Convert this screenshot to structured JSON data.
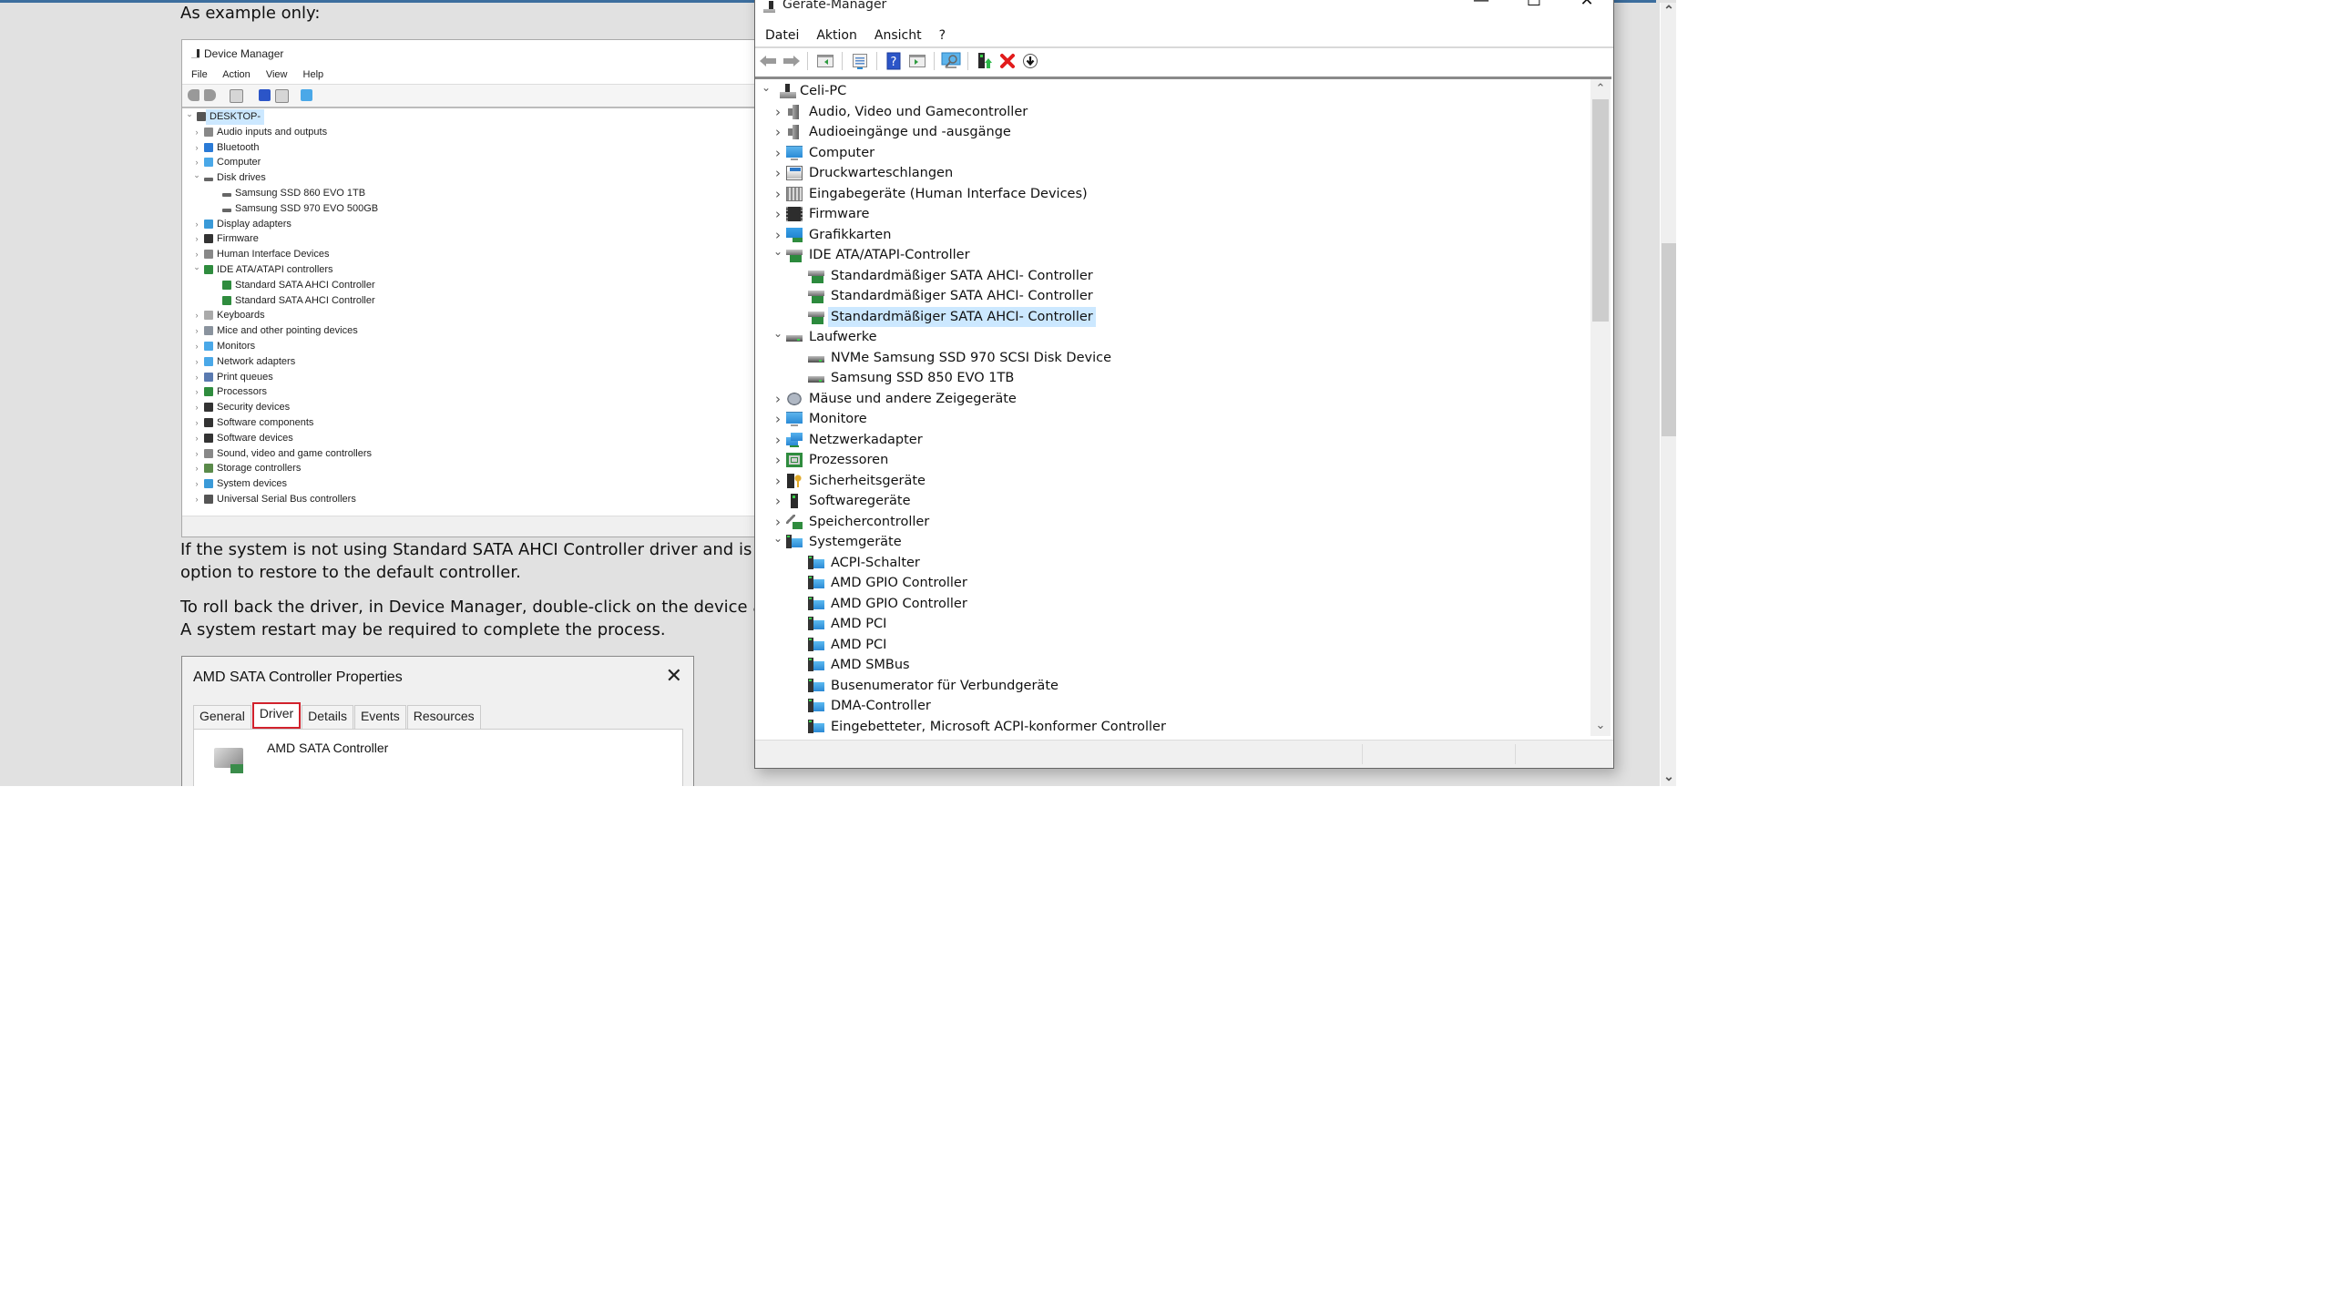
{
  "page": {
    "intro_label": "As example only:",
    "paragraph1_line1": "If the system is not using Standard SATA AHCI Controller driver and is experie",
    "paragraph1_line2": "option to restore to the default controller.",
    "paragraph2_line1": "To roll back the driver, in Device Manager, double-click on the device and sele",
    "paragraph2_line2": "A system restart may be required to complete the process."
  },
  "example_device_manager": {
    "title": "Device Manager",
    "menu": [
      "File",
      "Action",
      "View",
      "Help"
    ],
    "root": "DESKTOP-",
    "items": [
      {
        "label": "Audio inputs and outputs",
        "level": 1,
        "state": "collapsed",
        "icon": "speaker-icon"
      },
      {
        "label": "Bluetooth",
        "level": 1,
        "state": "collapsed",
        "icon": "bluetooth-icon"
      },
      {
        "label": "Computer",
        "level": 1,
        "state": "collapsed",
        "icon": "monitor-icon"
      },
      {
        "label": "Disk drives",
        "level": 1,
        "state": "expanded",
        "icon": "disk-icon"
      },
      {
        "label": "Samsung SSD 860 EVO 1TB",
        "level": 2,
        "state": "leaf",
        "icon": "disk-icon"
      },
      {
        "label": "Samsung SSD 970 EVO 500GB",
        "level": 2,
        "state": "leaf",
        "icon": "disk-icon"
      },
      {
        "label": "Display adapters",
        "level": 1,
        "state": "collapsed",
        "icon": "display-adapter-icon"
      },
      {
        "label": "Firmware",
        "level": 1,
        "state": "collapsed",
        "icon": "chip-icon"
      },
      {
        "label": "Human Interface Devices",
        "level": 1,
        "state": "collapsed",
        "icon": "hid-icon"
      },
      {
        "label": "IDE ATA/ATAPI controllers",
        "level": 1,
        "state": "expanded",
        "icon": "ide-controller-icon"
      },
      {
        "label": "Standard SATA AHCI Controller",
        "level": 2,
        "state": "leaf",
        "icon": "ide-controller-icon"
      },
      {
        "label": "Standard SATA AHCI Controller",
        "level": 2,
        "state": "leaf",
        "icon": "ide-controller-icon"
      },
      {
        "label": "Keyboards",
        "level": 1,
        "state": "collapsed",
        "icon": "keyboard-icon"
      },
      {
        "label": "Mice and other pointing devices",
        "level": 1,
        "state": "collapsed",
        "icon": "mouse-icon"
      },
      {
        "label": "Monitors",
        "level": 1,
        "state": "collapsed",
        "icon": "monitor-icon"
      },
      {
        "label": "Network adapters",
        "level": 1,
        "state": "collapsed",
        "icon": "network-icon"
      },
      {
        "label": "Print queues",
        "level": 1,
        "state": "collapsed",
        "icon": "printer-icon"
      },
      {
        "label": "Processors",
        "level": 1,
        "state": "collapsed",
        "icon": "cpu-icon"
      },
      {
        "label": "Security devices",
        "level": 1,
        "state": "collapsed",
        "icon": "security-icon"
      },
      {
        "label": "Software components",
        "level": 1,
        "state": "collapsed",
        "icon": "software-component-icon"
      },
      {
        "label": "Software devices",
        "level": 1,
        "state": "collapsed",
        "icon": "software-device-icon"
      },
      {
        "label": "Sound, video and game controllers",
        "level": 1,
        "state": "collapsed",
        "icon": "speaker-icon"
      },
      {
        "label": "Storage controllers",
        "level": 1,
        "state": "collapsed",
        "icon": "storage-icon"
      },
      {
        "label": "System devices",
        "level": 1,
        "state": "collapsed",
        "icon": "system-device-icon"
      },
      {
        "label": "Universal Serial Bus controllers",
        "level": 1,
        "state": "collapsed",
        "icon": "usb-icon"
      }
    ]
  },
  "properties_dialog": {
    "title": "AMD SATA Controller Properties",
    "close_glyph": "✕",
    "tabs": [
      {
        "label": "General",
        "active": false
      },
      {
        "label": "Driver",
        "active": true,
        "highlighted": true
      },
      {
        "label": "Details",
        "active": false
      },
      {
        "label": "Events",
        "active": false
      },
      {
        "label": "Resources",
        "active": false
      }
    ],
    "device_name": "AMD SATA Controller",
    "highlight_color": "#d2222d"
  },
  "geraete_manager": {
    "title": "Geräte-Manager",
    "window_controls": {
      "minimize": "—",
      "maximize": "☐",
      "close": "✕"
    },
    "menu": [
      "Datei",
      "Aktion",
      "Ansicht",
      "?"
    ],
    "toolbar": [
      {
        "name": "back",
        "icon": "back-arrow-icon"
      },
      {
        "name": "forward",
        "icon": "forward-arrow-icon"
      },
      {
        "name": "show-hide-console-tree",
        "icon": "console-tree-icon"
      },
      {
        "name": "properties",
        "icon": "properties-icon"
      },
      {
        "name": "help",
        "icon": "help-icon",
        "glyph": "?"
      },
      {
        "name": "action-pane",
        "icon": "action-pane-icon"
      },
      {
        "name": "scan-hardware",
        "icon": "scan-hardware-icon"
      },
      {
        "name": "update-driver",
        "icon": "update-driver-icon"
      },
      {
        "name": "uninstall-device",
        "icon": "uninstall-icon",
        "glyph": "✖"
      },
      {
        "name": "disable-device",
        "icon": "disable-device-icon",
        "glyph": "⬇"
      }
    ],
    "root": "Celi-PC",
    "items": [
      {
        "label": "Audio, Video und Gamecontroller",
        "level": 1,
        "state": "collapsed",
        "icon": "speaker"
      },
      {
        "label": "Audioeingänge und -ausgänge",
        "level": 1,
        "state": "collapsed",
        "icon": "speaker"
      },
      {
        "label": "Computer",
        "level": 1,
        "state": "collapsed",
        "icon": "monitor"
      },
      {
        "label": "Druckwarteschlangen",
        "level": 1,
        "state": "collapsed",
        "icon": "printer"
      },
      {
        "label": "Eingabegeräte (Human Interface Devices)",
        "level": 1,
        "state": "collapsed",
        "icon": "hid"
      },
      {
        "label": "Firmware",
        "level": 1,
        "state": "collapsed",
        "icon": "chip"
      },
      {
        "label": "Grafikkarten",
        "level": 1,
        "state": "collapsed",
        "icon": "gpu"
      },
      {
        "label": "IDE ATA/ATAPI-Controller",
        "level": 1,
        "state": "expanded",
        "icon": "ide"
      },
      {
        "label": "Standardmäßiger SATA AHCI- Controller",
        "level": 2,
        "state": "leaf",
        "icon": "ide"
      },
      {
        "label": "Standardmäßiger SATA AHCI- Controller",
        "level": 2,
        "state": "leaf",
        "icon": "ide"
      },
      {
        "label": "Standardmäßiger SATA AHCI- Controller",
        "level": 2,
        "state": "leaf",
        "icon": "ide",
        "selected": true
      },
      {
        "label": "Laufwerke",
        "level": 1,
        "state": "expanded",
        "icon": "disk"
      },
      {
        "label": "NVMe Samsung SSD 970 SCSI Disk Device",
        "level": 2,
        "state": "leaf",
        "icon": "disk"
      },
      {
        "label": "Samsung SSD 850 EVO 1TB",
        "level": 2,
        "state": "leaf",
        "icon": "disk"
      },
      {
        "label": "Mäuse und andere Zeigegeräte",
        "level": 1,
        "state": "collapsed",
        "icon": "mouse"
      },
      {
        "label": "Monitore",
        "level": 1,
        "state": "collapsed",
        "icon": "monitor"
      },
      {
        "label": "Netzwerkadapter",
        "level": 1,
        "state": "collapsed",
        "icon": "net"
      },
      {
        "label": "Prozessoren",
        "level": 1,
        "state": "collapsed",
        "icon": "cpu"
      },
      {
        "label": "Sicherheitsgeräte",
        "level": 1,
        "state": "collapsed",
        "icon": "sec"
      },
      {
        "label": "Softwaregeräte",
        "level": 1,
        "state": "collapsed",
        "icon": "soft"
      },
      {
        "label": "Speichercontroller",
        "level": 1,
        "state": "collapsed",
        "icon": "store"
      },
      {
        "label": "Systemgeräte",
        "level": 1,
        "state": "expanded",
        "icon": "sys"
      },
      {
        "label": "ACPI-Schalter",
        "level": 2,
        "state": "leaf",
        "icon": "sys"
      },
      {
        "label": "AMD GPIO Controller",
        "level": 2,
        "state": "leaf",
        "icon": "sys"
      },
      {
        "label": "AMD GPIO Controller",
        "level": 2,
        "state": "leaf",
        "icon": "sys"
      },
      {
        "label": "AMD PCI",
        "level": 2,
        "state": "leaf",
        "icon": "sys"
      },
      {
        "label": "AMD PCI",
        "level": 2,
        "state": "leaf",
        "icon": "sys"
      },
      {
        "label": "AMD SMBus",
        "level": 2,
        "state": "leaf",
        "icon": "sys"
      },
      {
        "label": "Busenumerator für Verbundgeräte",
        "level": 2,
        "state": "leaf",
        "icon": "sys"
      },
      {
        "label": "DMA-Controller",
        "level": 2,
        "state": "leaf",
        "icon": "sys"
      },
      {
        "label": "Eingebetteter, Microsoft ACPI-konformer Controller",
        "level": 2,
        "state": "leaf",
        "icon": "sys"
      }
    ],
    "scrollbar": {
      "up_glyph": "⌃",
      "down_glyph": "⌄",
      "visible_fraction": 0.36,
      "position": 0.0
    }
  },
  "page_scrollbar": {
    "up_glyph": "⌃",
    "down_glyph": "⌄",
    "visible_fraction": 0.26,
    "position": 0.4
  },
  "colors": {
    "selection": "#cce8ff",
    "page_background": "#e1e1e1",
    "top_strip": "#3c6e9e",
    "uninstall_red": "#e21b1b",
    "help_blue": "#2b55c8"
  }
}
